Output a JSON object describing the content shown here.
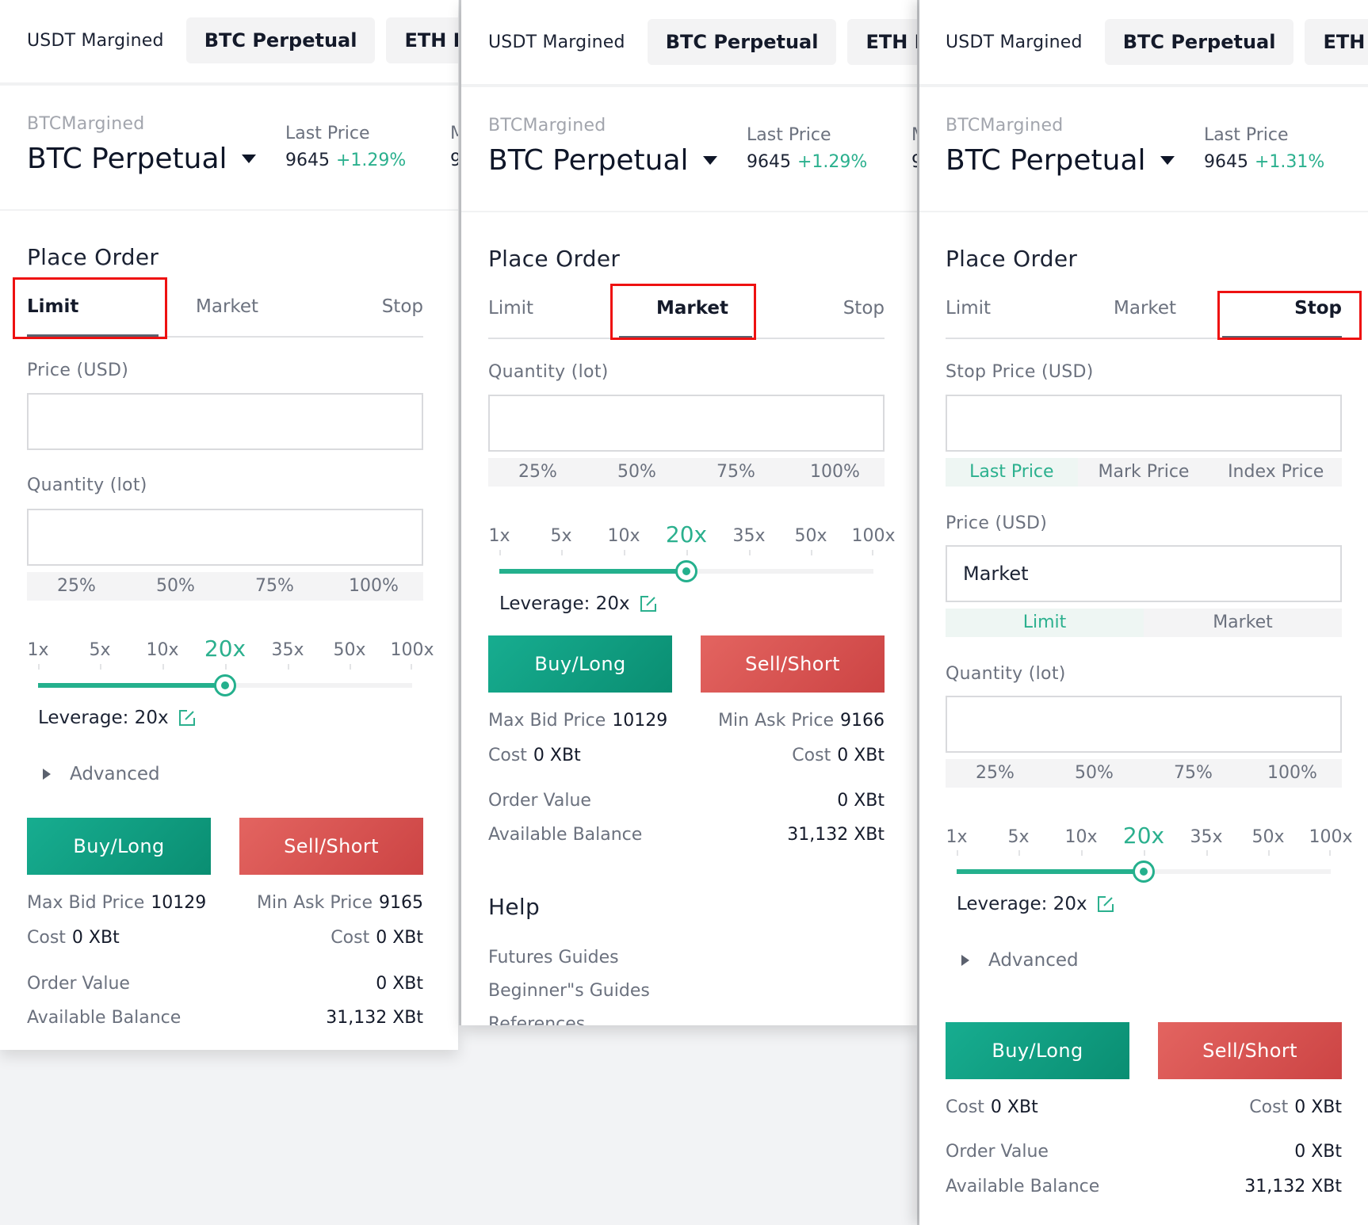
{
  "colors": {
    "accent_green": "#2bb08e",
    "buy": "#0f9e80",
    "sell": "#d9514f",
    "highlight": "#ee1111"
  },
  "nav": {
    "plain": "USDT Margined",
    "chips": [
      "BTC Perpetual",
      "ETH Perp"
    ]
  },
  "symbol": {
    "sub": "BTCMargined",
    "main": "BTC Perpetual"
  },
  "last_price_label": "Last Price",
  "peek_labels": [
    "M",
    "9"
  ],
  "place_order": "Place Order",
  "tabs": [
    "Limit",
    "Market",
    "Stop"
  ],
  "percent_options": [
    "25%",
    "50%",
    "75%",
    "100%"
  ],
  "leverage_ticks": [
    "1x",
    "5x",
    "10x",
    "20x",
    "35x",
    "50x",
    "100x"
  ],
  "leverage": {
    "selected": "20x",
    "label": "Leverage: 20x"
  },
  "advanced": "Advanced",
  "buttons": {
    "buy": "Buy/Long",
    "sell": "Sell/Short"
  },
  "summary": {
    "max_bid_label": "Max Bid Price",
    "min_ask_label": "Min Ask Price",
    "cost_label": "Cost",
    "cost_value": "0 XBt",
    "order_value_label": "Order Value",
    "order_value": "0 XBt",
    "balance_label": "Available Balance",
    "balance": "31,132 XBt"
  },
  "panels": [
    {
      "active_tab": "Limit",
      "last_price": "9645",
      "change": "+1.29%",
      "price_label": "Price (USD)",
      "price_value": "",
      "qty_label": "Quantity (lot)",
      "qty_value": "",
      "max_bid": "10129",
      "min_ask": "9165"
    },
    {
      "active_tab": "Market",
      "last_price": "9645",
      "change": "+1.29%",
      "qty_label": "Quantity (lot)",
      "qty_value": "",
      "max_bid": "10129",
      "min_ask": "9166",
      "help": {
        "title": "Help",
        "items": [
          "Futures Guides",
          "Beginner\"s Guides",
          "References"
        ]
      }
    },
    {
      "active_tab": "Stop",
      "last_price": "9645",
      "change": "+1.31%",
      "stop_price_label": "Stop Price (USD)",
      "stop_price_value": "",
      "trigger_options": [
        "Last Price",
        "Mark Price",
        "Index Price"
      ],
      "trigger_selected": "Last Price",
      "price_label": "Price (USD)",
      "price_value": "Market",
      "price_type_options": [
        "Limit",
        "Market"
      ],
      "price_type_selected": "Limit",
      "qty_label": "Quantity (lot)",
      "qty_value": ""
    }
  ]
}
